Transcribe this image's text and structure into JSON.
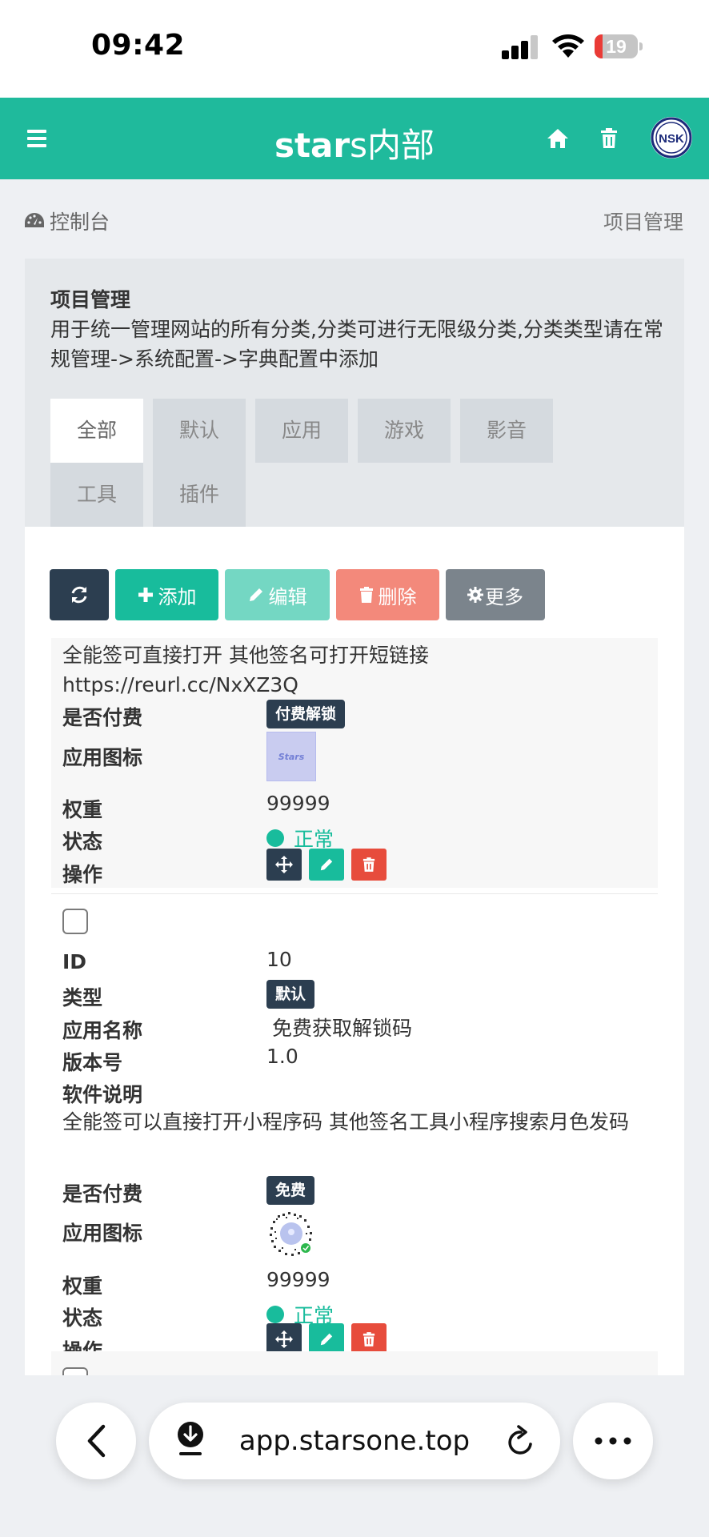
{
  "status_bar": {
    "time": "09:42",
    "battery": "19",
    "battery_level": 0.19
  },
  "navbar": {
    "brand_bold": "star",
    "brand_rest": "s内部",
    "avatar_text": "NSK",
    "icons": [
      "menu-icon",
      "home-icon",
      "trash-icon"
    ]
  },
  "breadcrumb": {
    "left": "控制台",
    "right": "项目管理"
  },
  "panel": {
    "title": "项目管理",
    "description": "用于统一管理网站的所有分类,分类可进行无限级分类,分类类型请在常规管理->系统配置->字典配置中添加",
    "tabs": [
      "全部",
      "默认",
      "应用",
      "游戏",
      "影音",
      "工具",
      "插件"
    ],
    "active_tab": "全部"
  },
  "toolbar": {
    "add": "添加",
    "edit": "编辑",
    "delete": "删除",
    "more": "更多"
  },
  "labels": {
    "id": "ID",
    "type": "类型",
    "app_name": "应用名称",
    "version": "版本号",
    "description": "软件说明",
    "paid": "是否付费",
    "icon": "应用图标",
    "weight": "权重",
    "status": "状态",
    "actions": "操作"
  },
  "records": [
    {
      "description_tail": "全能签可直接打开 其他签名可打开短链接 https://reurl.cc/NxXZ3Q",
      "paid": "付费解锁",
      "icon_text": "Stars",
      "weight": "99999",
      "status": "正常"
    },
    {
      "id": "10",
      "type": "默认",
      "app_name": "免费获取解锁码",
      "version": "1.0",
      "description": "全能签可以直接打开小程序码 其他签名工具小程序搜索月色发码",
      "paid": "免费",
      "weight": "99999",
      "status": "正常"
    }
  ],
  "browser": {
    "url": "app.starsone.top"
  },
  "colors": {
    "primary": "#18bc9c",
    "navbar": "#1fba9c",
    "dark": "#2c3e50",
    "danger": "#e74c3c",
    "gray": "#7b848c"
  }
}
